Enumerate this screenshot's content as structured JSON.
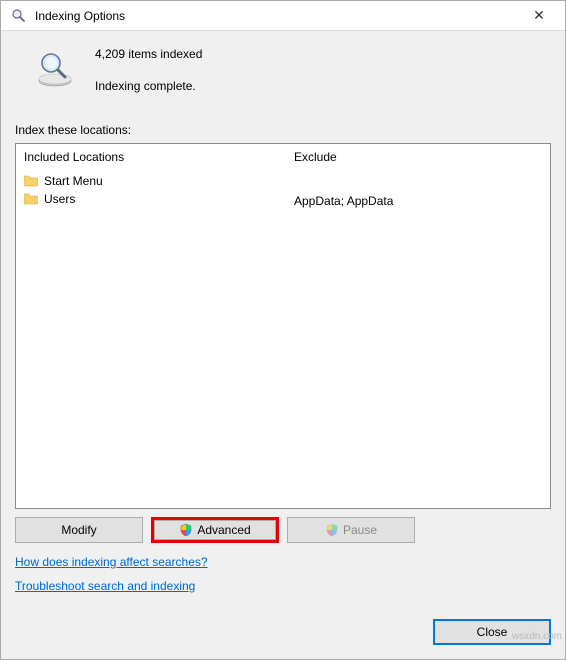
{
  "window": {
    "title": "Indexing Options",
    "close_glyph": "✕"
  },
  "status": {
    "count_line": "4,209 items indexed",
    "message": "Indexing complete."
  },
  "section": {
    "header": "Index these locations:",
    "col_included": "Included Locations",
    "col_exclude": "Exclude",
    "items": [
      {
        "name": "Start Menu",
        "exclude": ""
      },
      {
        "name": "Users",
        "exclude": "AppData; AppData"
      }
    ]
  },
  "buttons": {
    "modify": "Modify",
    "advanced": "Advanced",
    "pause": "Pause",
    "close": "Close"
  },
  "links": {
    "affect": "How does indexing affect searches?",
    "troubleshoot": "Troubleshoot search and indexing"
  },
  "watermark": "wsxdn.com"
}
